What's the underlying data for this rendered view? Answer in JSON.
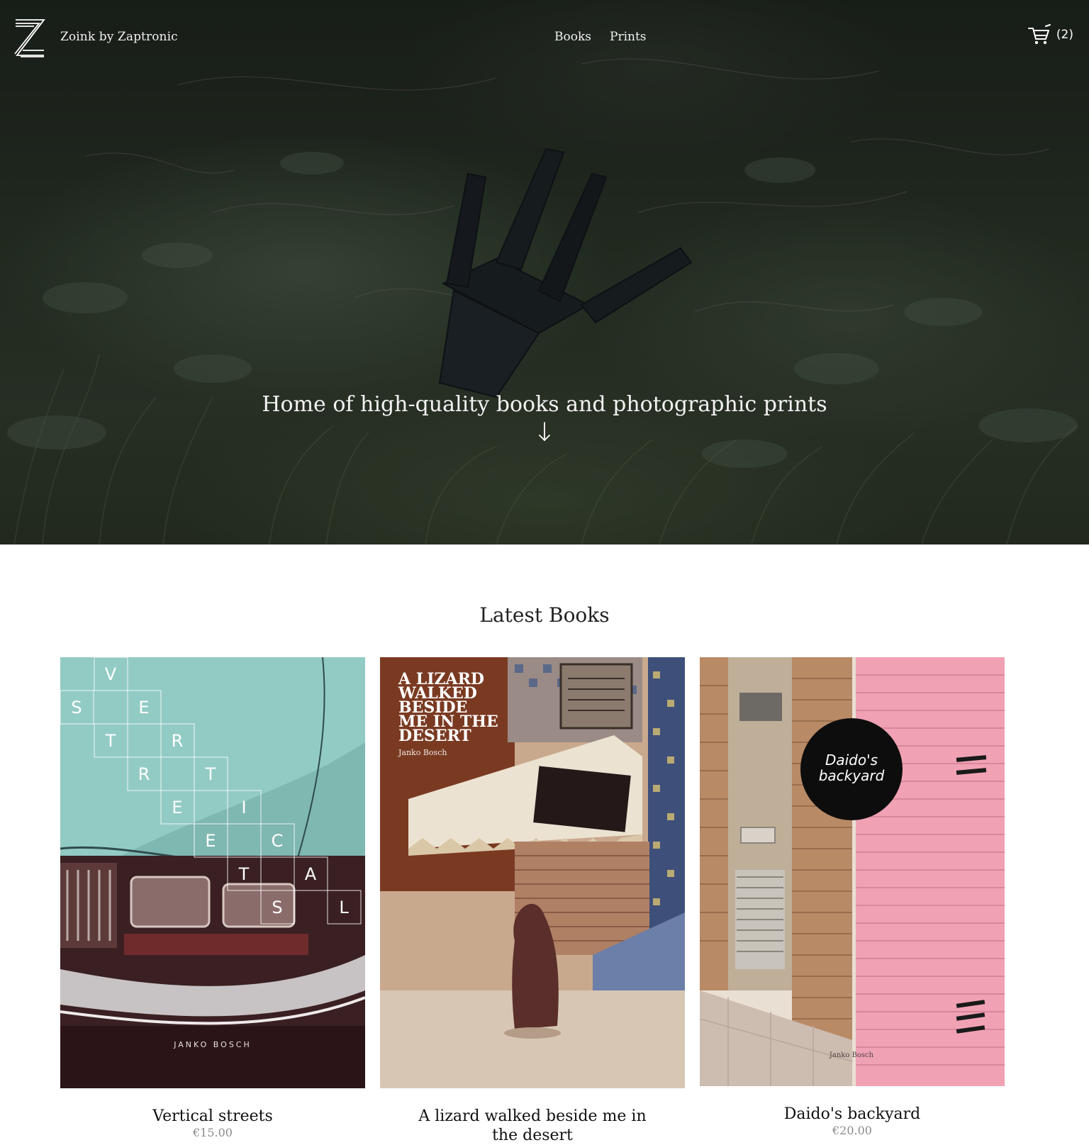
{
  "brand": {
    "name": "Zoink by Zaptronic"
  },
  "nav": {
    "items": [
      {
        "label": "Books"
      },
      {
        "label": "Prints"
      }
    ]
  },
  "cart": {
    "count_label": "(2)",
    "icon": "cart-icon"
  },
  "hero": {
    "tagline": "Home of high-quality books and photographic prints",
    "scroll_icon": "arrow-down-icon"
  },
  "latest_books": {
    "heading": "Latest Books",
    "books": [
      {
        "title": "Vertical streets",
        "price": "€15.00",
        "cover": {
          "letters": [
            "V",
            "S",
            "E",
            "T",
            "R",
            "R",
            "T",
            "E",
            "I",
            "E",
            "C",
            "T",
            "A",
            "S",
            "L"
          ],
          "author": "JANKO BOSCH",
          "accent": "#8fc9c2"
        }
      },
      {
        "title": "A lizard walked beside me in the desert",
        "price": "",
        "cover": {
          "title_lines": [
            "A LIZARD",
            "WALKED",
            "BESIDE",
            "ME IN THE",
            "DESERT"
          ],
          "author": "Janko Bosch",
          "accent": "#b0573a"
        }
      },
      {
        "title": "Daido's backyard",
        "price": "€20.00",
        "cover": {
          "title_lines": [
            "Daido's",
            "backyard"
          ],
          "author": "Janko Bosch",
          "accent": "#f2a3b4"
        }
      }
    ]
  }
}
